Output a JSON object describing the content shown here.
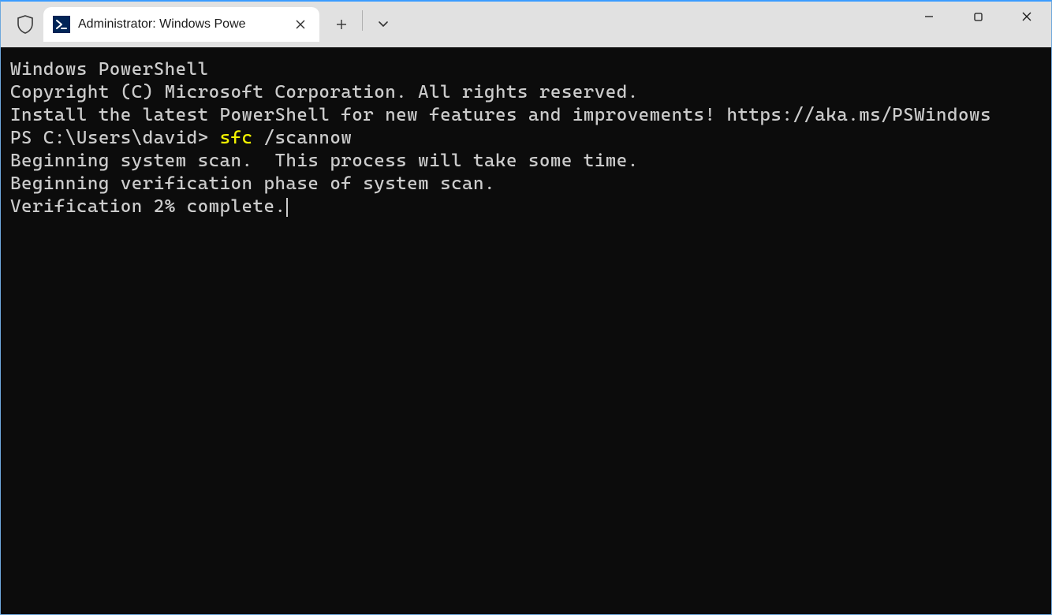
{
  "titlebar": {
    "tab_icon_glyph": ">_",
    "tab_title": "Administrator: Windows Powe",
    "close_label": "×",
    "newtab_label": "+",
    "dropdown_label": "⌄"
  },
  "terminal": {
    "line1": "Windows PowerShell",
    "line2": "Copyright (C) Microsoft Corporation. All rights reserved.",
    "line3": "",
    "line4": "Install the latest PowerShell for new features and improvements! https://aka.ms/PSWindows",
    "line5": "",
    "prompt": "PS C:\\Users\\david> ",
    "cmd_highlight": "sfc",
    "cmd_rest": " /scannow",
    "line7": "",
    "line8": "Beginning system scan.  This process will take some time.",
    "line9": "",
    "line10": "Beginning verification phase of system scan.",
    "line11": "Verification 2% complete."
  }
}
